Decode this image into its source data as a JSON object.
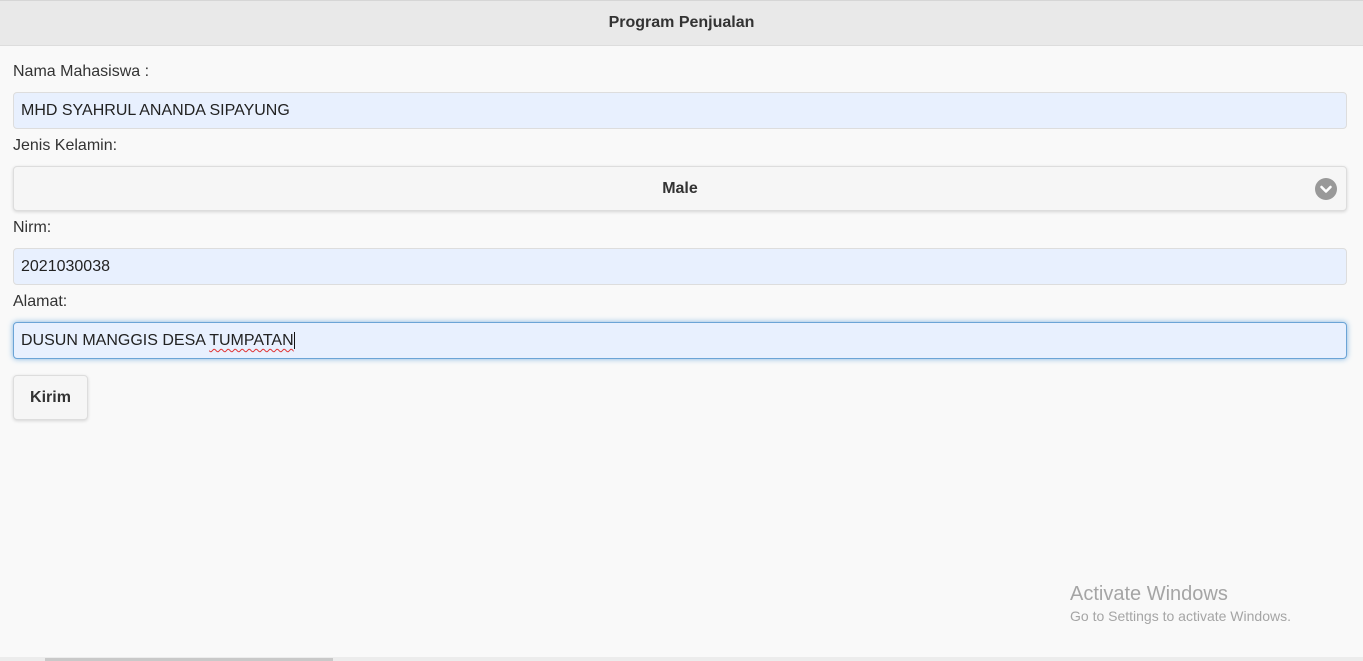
{
  "header": {
    "title": "Program Penjualan"
  },
  "form": {
    "nama": {
      "label": "Nama Mahasiswa :",
      "value": "MHD SYAHRUL ANANDA SIPAYUNG"
    },
    "jenis_kelamin": {
      "label": "Jenis Kelamin:",
      "selected": "Male"
    },
    "nirm": {
      "label": "Nirm:",
      "value": "2021030038"
    },
    "alamat": {
      "label": "Alamat:",
      "value_plain": "DUSUN MANGGIS DESA ",
      "value_misspelled": "TUMPATAN"
    },
    "submit_label": "Kirim"
  },
  "watermark": {
    "title": "Activate Windows",
    "subtitle": "Go to Settings to activate Windows."
  },
  "icons": {
    "select_arrow": "chevron-down-circle-icon"
  },
  "colors": {
    "input_background": "#e8f0fe",
    "focus_glow": "#7fb3e0",
    "header_background": "#e9e9e9"
  }
}
